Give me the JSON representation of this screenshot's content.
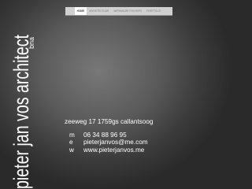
{
  "nav": {
    "items": [
      {
        "label": "home",
        "active": true
      },
      {
        "label": "architectuur",
        "active": false
      },
      {
        "label": "werkwijze pjvos/pv",
        "active": false
      },
      {
        "label": "portfolio",
        "active": false
      }
    ]
  },
  "logo": {
    "name": "pieter jan vos architect",
    "suffix": "bna"
  },
  "contact": {
    "address": "zeeweg 17 1759gs callantsoog",
    "rows": [
      {
        "label": "m",
        "value": "06 34 88 96 95"
      },
      {
        "label": "e",
        "value": "pieterjanvos@me.com"
      },
      {
        "label": "w",
        "value": "www.pieterjanvos.me"
      }
    ]
  },
  "colors": {
    "text": "#ffffff",
    "nav_bg": "#d0d0d0",
    "background": "#505050"
  }
}
